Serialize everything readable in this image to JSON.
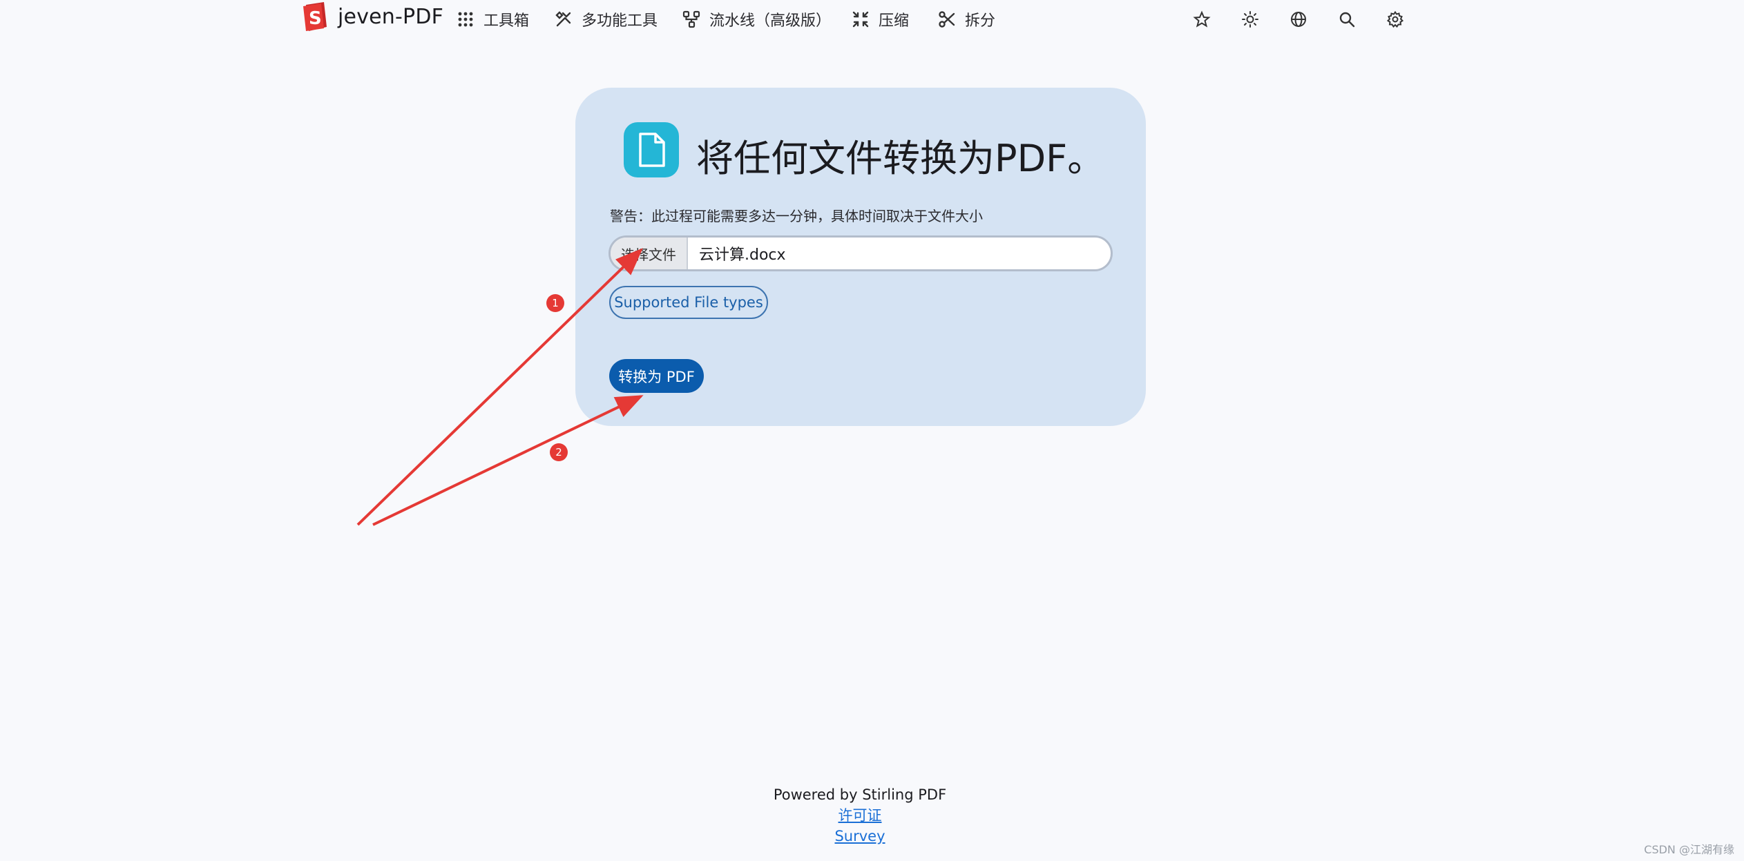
{
  "brand": {
    "name": "jeven-PDF"
  },
  "nav": {
    "items": [
      {
        "label": "工具箱",
        "icon": "grid-dots-icon"
      },
      {
        "label": "多功能工具",
        "icon": "tools-icon"
      },
      {
        "label": "流水线（高级版）",
        "icon": "pipeline-icon"
      },
      {
        "label": "压缩",
        "icon": "compress-icon"
      },
      {
        "label": "拆分",
        "icon": "scissors-icon"
      }
    ],
    "icons": [
      "star-icon",
      "sun-icon",
      "globe-icon",
      "search-icon",
      "gear-icon"
    ]
  },
  "card": {
    "icon": "file-icon",
    "title": "将任何文件转换为PDF。",
    "warning": "警告：此过程可能需要多达一分钟，具体时间取决于文件大小",
    "file_input": {
      "button_label": "选择文件",
      "file_name": "云计算.docx"
    },
    "types_button": "Supported File types",
    "convert_button": "转换为 PDF"
  },
  "annotations": {
    "badge_1": "1",
    "badge_2": "2",
    "color": "#e53935"
  },
  "footer": {
    "powered": "Powered by Stirling PDF",
    "license": "许可证",
    "survey": "Survey"
  },
  "watermark": "CSDN @江湖有缘"
}
